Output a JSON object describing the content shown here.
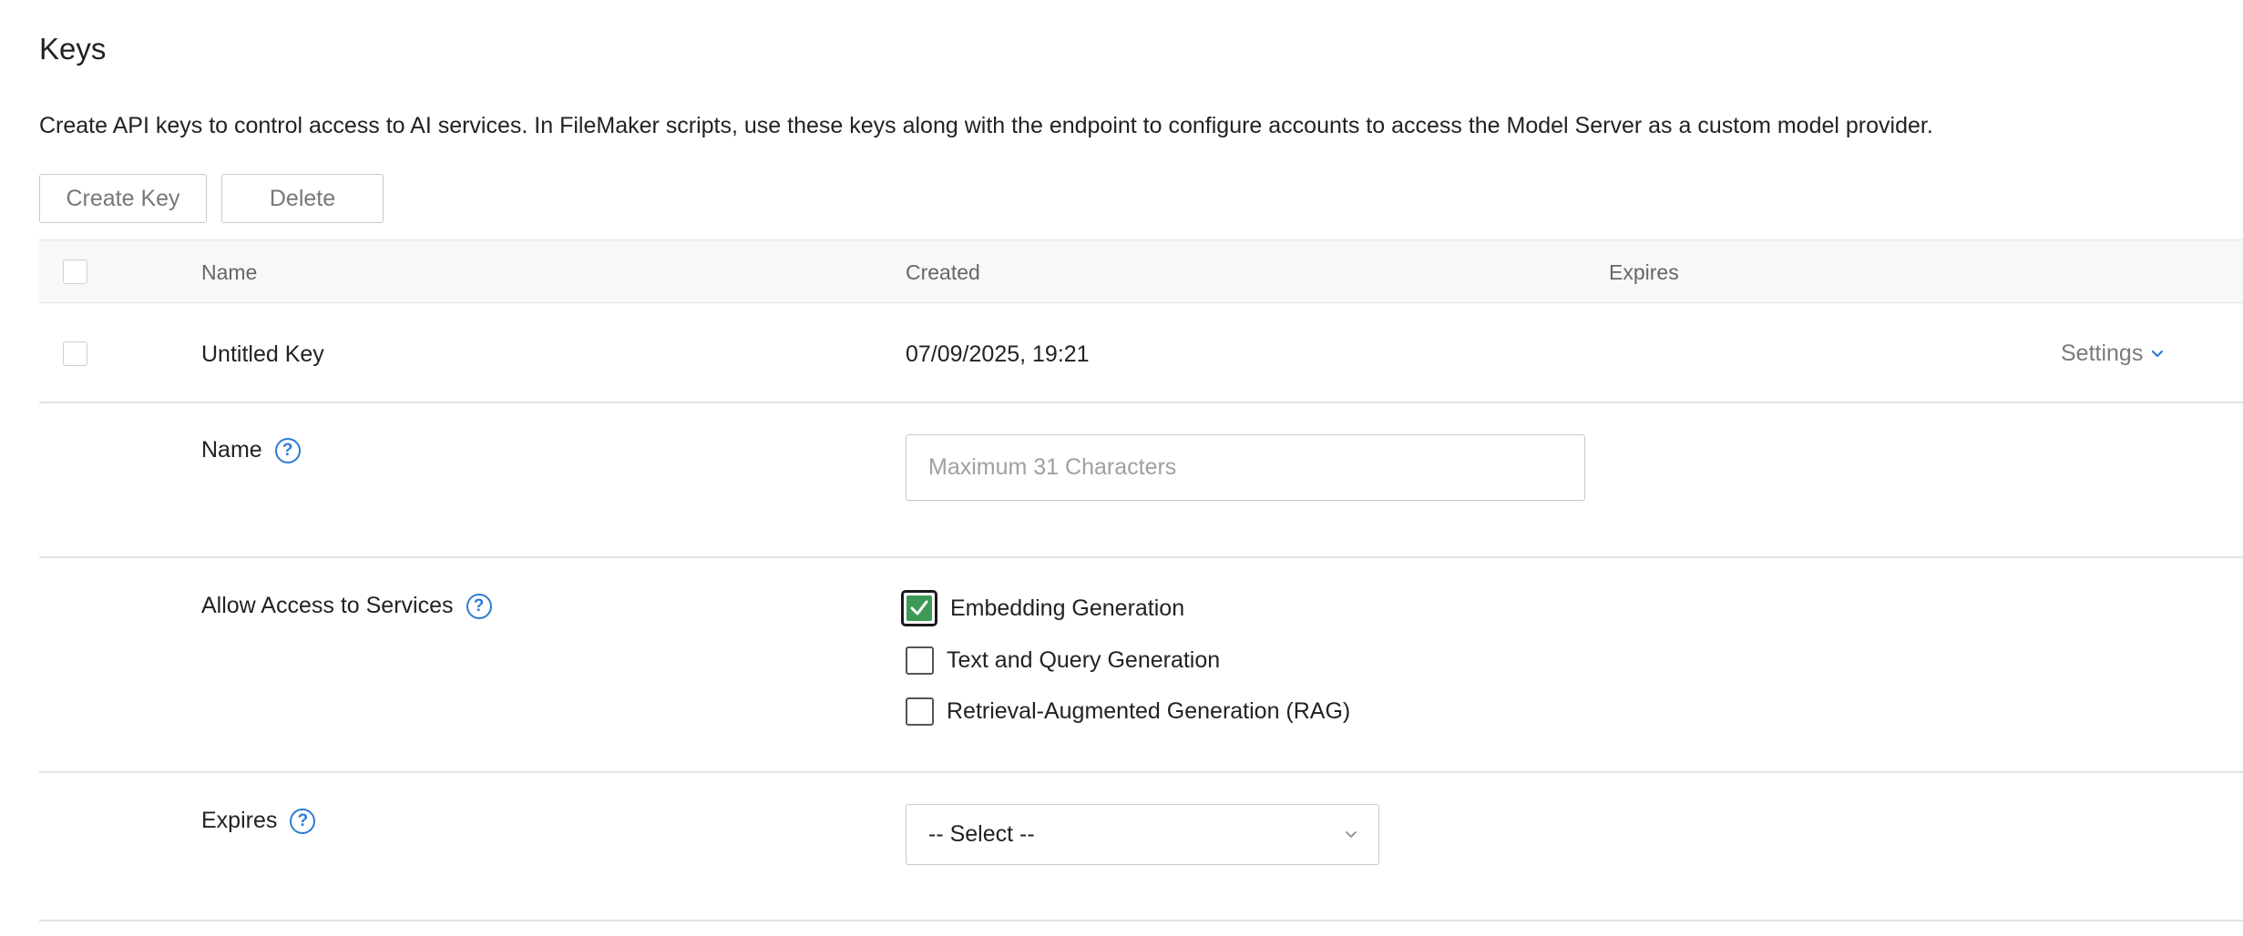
{
  "page": {
    "title": "Keys",
    "description": "Create API keys to control access to AI services. In FileMaker scripts, use these keys along with the endpoint to configure accounts to access the Model Server as a custom model provider."
  },
  "toolbar": {
    "create_label": "Create Key",
    "delete_label": "Delete"
  },
  "table": {
    "columns": [
      "Name",
      "Created",
      "Expires"
    ],
    "rows": [
      {
        "name": "Untitled Key",
        "created": "07/09/2025, 19:21",
        "expires": "",
        "settings_label": "Settings"
      }
    ]
  },
  "settings_panel": {
    "name_label": "Name",
    "name_placeholder": "Maximum 31 Characters",
    "name_value": "",
    "services_label": "Allow Access to Services",
    "services": [
      {
        "label": "Embedding Generation",
        "checked": true
      },
      {
        "label": "Text and Query Generation",
        "checked": false
      },
      {
        "label": "Retrieval-Augmented Generation (RAG)",
        "checked": false
      }
    ],
    "expires_label": "Expires",
    "expires_selected": "-- Select --"
  },
  "colors": {
    "accent_blue": "#2e7bd6",
    "check_green": "#3d9a56",
    "border_gray": "#c9c9c9"
  },
  "icons": {
    "help": "question-circle-icon",
    "chevron": "chevron-down-icon",
    "check": "checkmark-icon"
  }
}
